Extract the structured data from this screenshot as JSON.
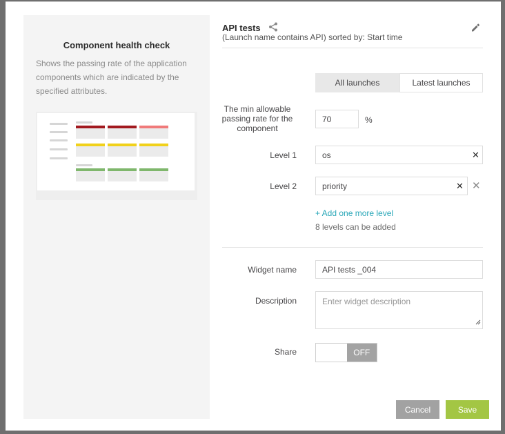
{
  "left_panel": {
    "title": "Component health check",
    "description": "Shows the passing rate of the application components which are indicated by the specified attributes.",
    "preview_colors": {
      "dark_red": "#a2191f",
      "light_red": "#f07a7a",
      "yellow": "#f1d11a",
      "green": "#7fb76c"
    }
  },
  "header": {
    "title": "API tests",
    "subtitle": "(Launch name contains API) sorted by: Start time",
    "share_icon": "share-icon",
    "edit_icon": "pencil-icon"
  },
  "mode_tabs": {
    "all_label": "All launches",
    "latest_label": "Latest launches",
    "selected": "All launches"
  },
  "form": {
    "min_rate_label": "The min allowable passing rate for the component",
    "min_rate_value": "70",
    "min_rate_unit": "%",
    "level1_label": "Level 1",
    "level1_value": "os",
    "level2_label": "Level 2",
    "level2_value": "priority",
    "add_level_label": "+ Add one more level",
    "levels_note": "8 levels can be added",
    "widget_name_label": "Widget name",
    "widget_name_value": "API tests _004",
    "description_label": "Description",
    "description_placeholder": "Enter widget description",
    "share_label": "Share",
    "share_state": "OFF"
  },
  "footer": {
    "cancel_label": "Cancel",
    "save_label": "Save",
    "save_color": "#a3c644",
    "cancel_color": "#a2a2a2"
  }
}
